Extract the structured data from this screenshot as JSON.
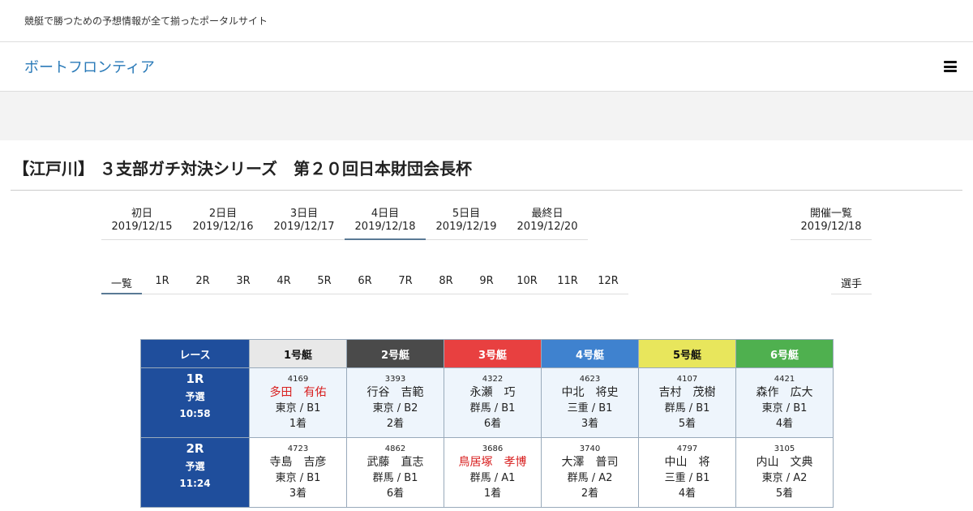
{
  "site": {
    "tagline": "競艇で勝つための予想情報が全て揃ったポータルサイト",
    "brand": "ボートフロンティア",
    "menu_icon": "hamburger-icon"
  },
  "page": {
    "title": "【江戸川】 ３支部ガチ対決シリーズ　第２０回日本財団会長杯"
  },
  "day_tabs": [
    {
      "label": "初日",
      "date": "2019/12/15"
    },
    {
      "label": "2日目",
      "date": "2019/12/16"
    },
    {
      "label": "3日目",
      "date": "2019/12/17"
    },
    {
      "label": "4日目",
      "date": "2019/12/18"
    },
    {
      "label": "5日目",
      "date": "2019/12/19"
    },
    {
      "label": "最終日",
      "date": "2019/12/20"
    }
  ],
  "active_day": 3,
  "kaisai": {
    "label": "開催一覧",
    "date": "2019/12/18"
  },
  "race_tabs": [
    "一覧",
    "1R",
    "2R",
    "3R",
    "4R",
    "5R",
    "6R",
    "7R",
    "8R",
    "9R",
    "10R",
    "11R",
    "12R"
  ],
  "senshu_label": "選手",
  "table": {
    "headers": [
      "レース",
      "1号艇",
      "2号艇",
      "3号艇",
      "4号艇",
      "5号艇",
      "6号艇"
    ],
    "header_colors": [
      "#1f4e9c",
      "#e8e8e8",
      "#4a4a4a",
      "#e84040",
      "#3f82cf",
      "#e8e65c",
      "#4fb04f"
    ],
    "rows": [
      {
        "race": "1R",
        "type": "予選",
        "time": "10:58",
        "boats": [
          {
            "reg": "4169",
            "name": "多田　有佑",
            "branch": "東京 / B1",
            "place": "1着",
            "winner": true
          },
          {
            "reg": "3393",
            "name": "行谷　吉範",
            "branch": "東京 / B2",
            "place": "2着",
            "winner": false
          },
          {
            "reg": "4322",
            "name": "永瀬　巧",
            "branch": "群馬 / B1",
            "place": "6着",
            "winner": false
          },
          {
            "reg": "4623",
            "name": "中北　将史",
            "branch": "三重 / B1",
            "place": "3着",
            "winner": false
          },
          {
            "reg": "4107",
            "name": "吉村　茂樹",
            "branch": "群馬 / B1",
            "place": "5着",
            "winner": false
          },
          {
            "reg": "4421",
            "name": "森作　広大",
            "branch": "東京 / B1",
            "place": "4着",
            "winner": false
          }
        ]
      },
      {
        "race": "2R",
        "type": "予選",
        "time": "11:24",
        "boats": [
          {
            "reg": "4723",
            "name": "寺島　吉彦",
            "branch": "東京 / B1",
            "place": "3着",
            "winner": false
          },
          {
            "reg": "4862",
            "name": "武藤　直志",
            "branch": "群馬 / B1",
            "place": "6着",
            "winner": false
          },
          {
            "reg": "3686",
            "name": "鳥居塚　孝博",
            "branch": "群馬 / A1",
            "place": "1着",
            "winner": true
          },
          {
            "reg": "3740",
            "name": "大澤　普司",
            "branch": "群馬 / A2",
            "place": "2着",
            "winner": false
          },
          {
            "reg": "4797",
            "name": "中山　将",
            "branch": "三重 / B1",
            "place": "4着",
            "winner": false
          },
          {
            "reg": "3105",
            "name": "内山　文典",
            "branch": "東京 / A2",
            "place": "5着",
            "winner": false
          }
        ]
      }
    ]
  }
}
